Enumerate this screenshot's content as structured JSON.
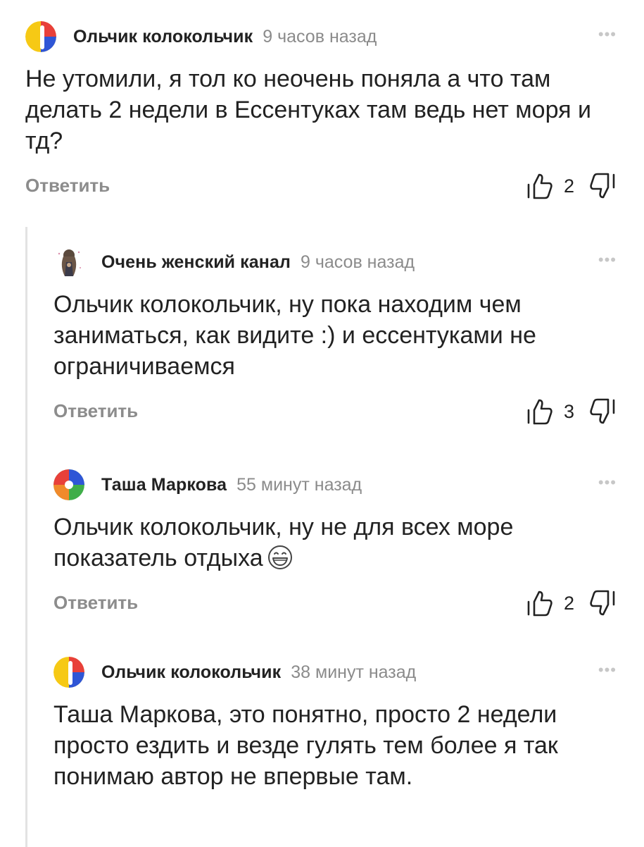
{
  "comments": [
    {
      "author": "Ольчик колокольчик",
      "time": "9 часов назад",
      "text": "Не утомили, я тол ко неочень поняла а что там делать 2 недели в Ессентуках там ведь нет моря и тд?",
      "reply_label": "Ответить",
      "likes": "2"
    },
    {
      "author": "Очень женский канал",
      "time": "9 часов назад",
      "text": "Ольчик колокольчик, ну пока находим чем заниматься, как видите :) и ессентуками не ограничиваемся",
      "reply_label": "Ответить",
      "likes": "3"
    },
    {
      "author": "Таша Маркова",
      "time": "55 минут назад",
      "text": "Ольчик колокольчик, ну не для всех море показатель отдыха",
      "reply_label": "Ответить",
      "likes": "2"
    },
    {
      "author": "Ольчик колокольчик",
      "time": "38 минут назад",
      "text": "Таша Маркова, это понятно, просто 2 недели просто ездить и везде гулять тем более я так понимаю автор не впервые там."
    }
  ],
  "icons": {
    "more": "more-dots-icon",
    "like": "thumbs-up-icon",
    "dislike": "thumbs-down-icon",
    "emoji": "grinning-face-emoji-icon"
  },
  "colors": {
    "avatar_yellow": "#f6c915",
    "avatar_blue": "#2f56d6",
    "avatar_red": "#e8403a",
    "avatar_green": "#3fae49",
    "avatar_orange": "#f08a2b",
    "muted_text": "#8b8b8b"
  }
}
